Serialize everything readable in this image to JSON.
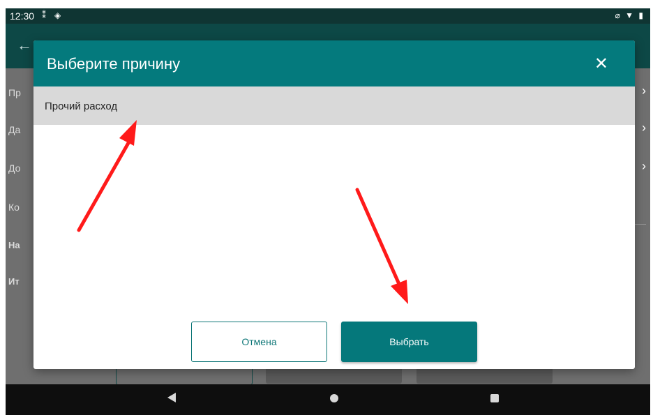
{
  "status_bar": {
    "time": "12:30",
    "left_icons": [
      "sim-icon",
      "data-icon"
    ],
    "right_icons": [
      "alarm-off-icon",
      "wifi-icon",
      "battery-icon"
    ]
  },
  "app_bar": {
    "back_icon": "back-arrow-icon"
  },
  "background_rows": [
    {
      "label_fragment": "Пр"
    },
    {
      "label_fragment": "Да"
    },
    {
      "label_fragment": "До"
    },
    {
      "label_fragment": "Ко"
    },
    {
      "label_fragment": "На"
    },
    {
      "label_fragment": "Ит"
    }
  ],
  "dialog": {
    "title": "Выберите причину",
    "close_icon": "close-icon",
    "reasons": [
      {
        "label": "Прочий расход",
        "selected": true
      }
    ],
    "cancel_label": "Отмена",
    "select_label": "Выбрать"
  },
  "navigation": {
    "back": "back-triangle-icon",
    "home": "home-circle-icon",
    "recents": "recents-square-icon"
  },
  "colors": {
    "header_teal": "#047a7d",
    "app_bar": "#0d4846",
    "status_bar": "#0f3533",
    "selected_row": "#d9d9d9",
    "annotation_red": "#ff1a1a"
  }
}
